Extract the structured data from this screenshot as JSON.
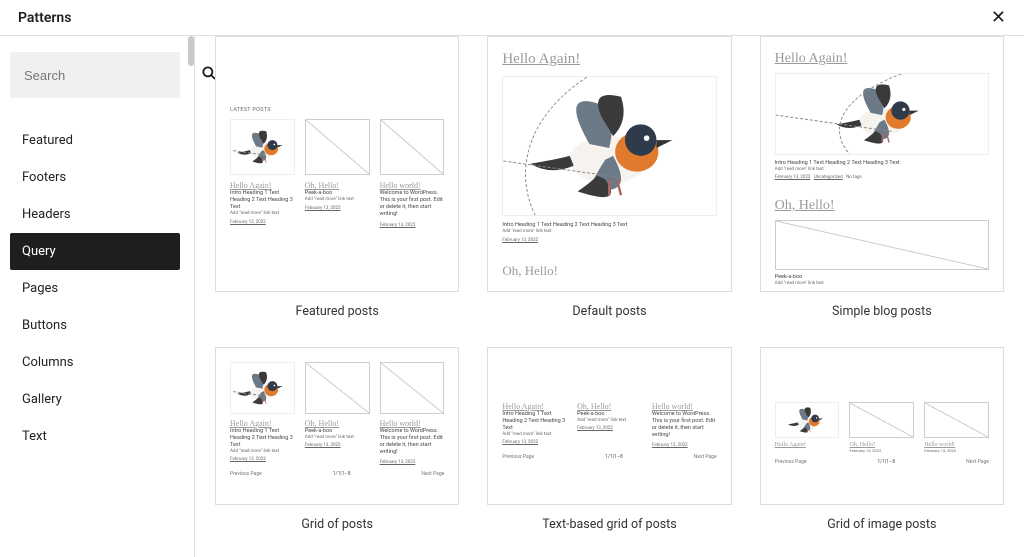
{
  "header": {
    "title": "Patterns",
    "close_label": "Close"
  },
  "search": {
    "placeholder": "Search"
  },
  "categories": [
    {
      "label": "Featured"
    },
    {
      "label": "Footers"
    },
    {
      "label": "Headers"
    },
    {
      "label": "Query",
      "active": true
    },
    {
      "label": "Pages"
    },
    {
      "label": "Buttons"
    },
    {
      "label": "Columns"
    },
    {
      "label": "Gallery"
    },
    {
      "label": "Text"
    }
  ],
  "patterns": {
    "featured_posts": {
      "label": "Featured posts"
    },
    "default_posts": {
      "label": "Default posts"
    },
    "simple_blog": {
      "label": "Simple blog posts"
    },
    "grid_of_posts": {
      "label": "Grid of posts"
    },
    "text_grid": {
      "label": "Text-based grid of posts"
    },
    "image_grid": {
      "label": "Grid of image posts"
    }
  },
  "preview": {
    "latest_posts": "LATEST POSTS",
    "hello_again": "Hello Again!",
    "oh_hello": "Oh, Hello!",
    "hello_world": "Hello world!",
    "intro": "Intro Heading 1 Text Heading 2 Text Heading 3 Text",
    "peek": "Peek-a-boo",
    "wp_first": "Welcome to WordPress. This is your first post. Edit or delete it, then start writing!",
    "read_more": "Add \"read more\" link text",
    "date": "February 13, 2022",
    "uncategorized": "Uncategorized",
    "no_tags": "No tags",
    "prev": "Previous Page",
    "next": "Next Page",
    "pager": "1/1|1–8"
  }
}
